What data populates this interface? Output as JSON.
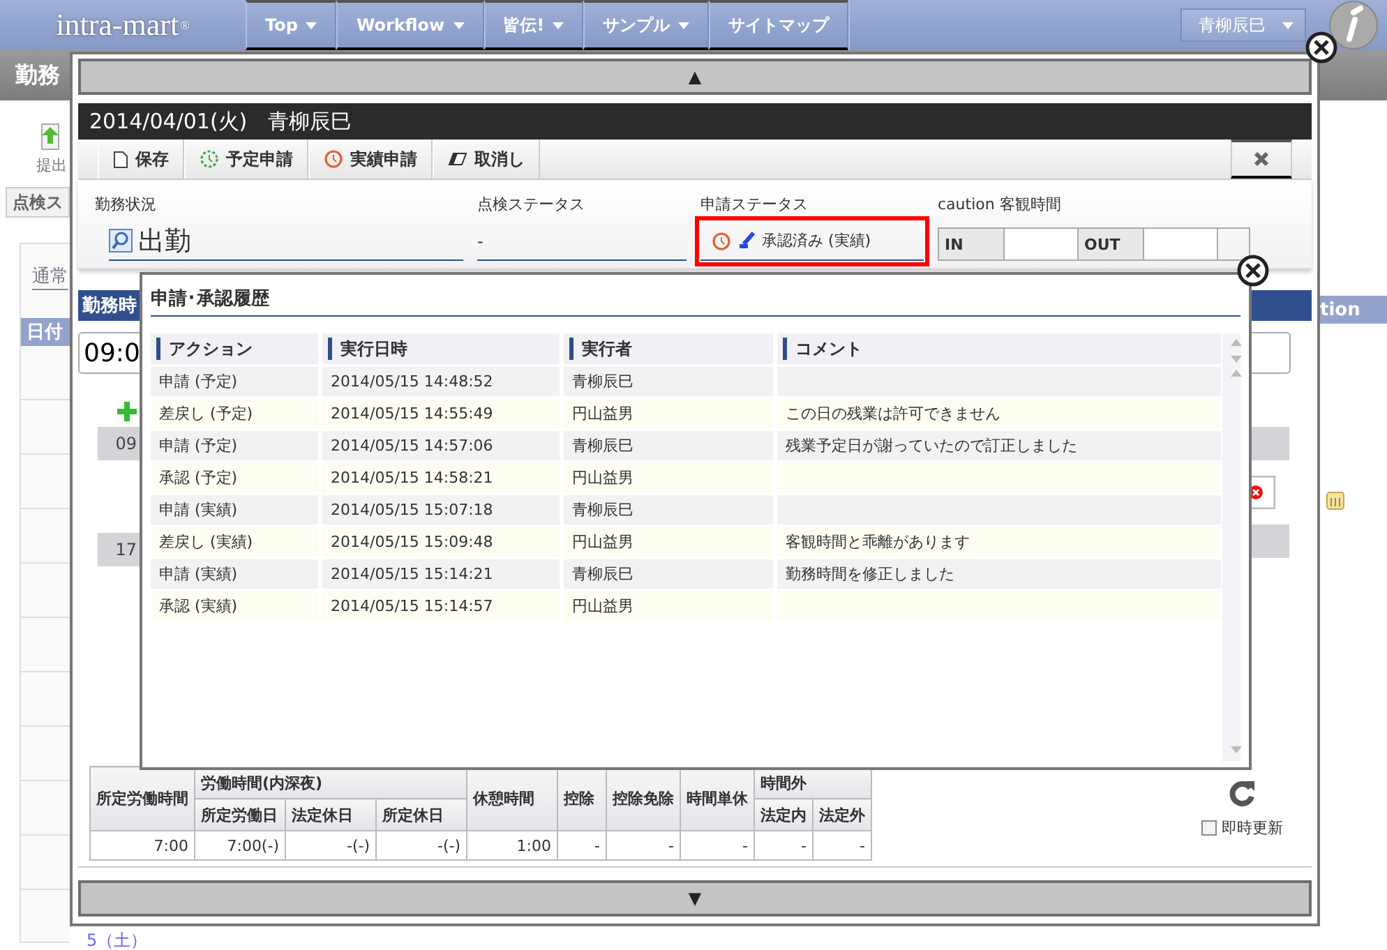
{
  "nav": {
    "logo": "intra-mart",
    "logo_mark": "®",
    "items": [
      {
        "label": "Top",
        "has_menu": true
      },
      {
        "label": "Workflow",
        "has_menu": true
      },
      {
        "label": "皆伝!",
        "has_menu": true
      },
      {
        "label": "サンプル",
        "has_menu": true
      },
      {
        "label": "サイトマップ",
        "has_menu": false
      }
    ],
    "user": "青柳辰巳"
  },
  "page": {
    "title": "勤務",
    "toolbar_button": "提出",
    "tab": "点検ス",
    "link": "通常",
    "table_header": "日付",
    "column_header": "tion",
    "footer_row": "5（土）"
  },
  "dialog": {
    "up_arrow": "▲",
    "down_arrow": "▼",
    "title": "2014/04/01(火)　青柳辰巳",
    "toolbar": [
      {
        "label": "保存",
        "kind": "save"
      },
      {
        "label": "予定申請",
        "kind": "plan"
      },
      {
        "label": "実績申請",
        "kind": "actual"
      },
      {
        "label": "取消し",
        "kind": "cancel"
      }
    ],
    "status": {
      "work_label": "勤務状況",
      "work_value": "出勤",
      "check_label": "点検ステータス",
      "check_value": "-",
      "apply_label": "申請ステータス",
      "apply_value": "承認済み (実績)",
      "apply_highlighted": true,
      "objective_label": "caution 客観時間",
      "in_label": "IN",
      "out_label": "OUT"
    },
    "body": {
      "section": "勤務時",
      "time_input": "09:0",
      "times": [
        "09",
        "17"
      ]
    },
    "summary": {
      "groups": [
        {
          "label": "所定労働時間"
        },
        {
          "label": "労働時間(内深夜)",
          "sub": [
            "所定労働日",
            "法定休日",
            "所定休日"
          ]
        },
        {
          "label": "休憩時間"
        },
        {
          "label": "控除"
        },
        {
          "label": "控除免除"
        },
        {
          "label": "時間単休"
        },
        {
          "label": "時間外",
          "sub": [
            "法定内",
            "法定外"
          ]
        }
      ],
      "values": [
        "7:00",
        "7:00(-)",
        "-(-)",
        "-(-)",
        "1:00",
        "-",
        "-",
        "-",
        "-",
        "-"
      ]
    },
    "instant_update": {
      "label": "即時更新",
      "checked": false
    }
  },
  "history": {
    "title": "申請･承認履歴",
    "columns": [
      "アクション",
      "実行日時",
      "実行者",
      "コメント"
    ],
    "rows": [
      [
        "申請 (予定)",
        "2014/05/15 14:48:52",
        "青柳辰巳",
        ""
      ],
      [
        "差戻し (予定)",
        "2014/05/15 14:55:49",
        "円山益男",
        "この日の残業は許可できません"
      ],
      [
        "申請 (予定)",
        "2014/05/15 14:57:06",
        "青柳辰巳",
        "残業予定日が謝っていたので訂正しました"
      ],
      [
        "承認 (予定)",
        "2014/05/15 14:58:21",
        "円山益男",
        ""
      ],
      [
        "申請 (実績)",
        "2014/05/15 15:07:18",
        "青柳辰巳",
        ""
      ],
      [
        "差戻し (実績)",
        "2014/05/15 15:09:48",
        "円山益男",
        "客観時間と乖離があります"
      ],
      [
        "申請 (実績)",
        "2014/05/15 15:14:21",
        "青柳辰巳",
        "勤務時間を修正しました"
      ],
      [
        "承認 (実績)",
        "2014/05/15 15:14:57",
        "円山益男",
        ""
      ]
    ]
  }
}
